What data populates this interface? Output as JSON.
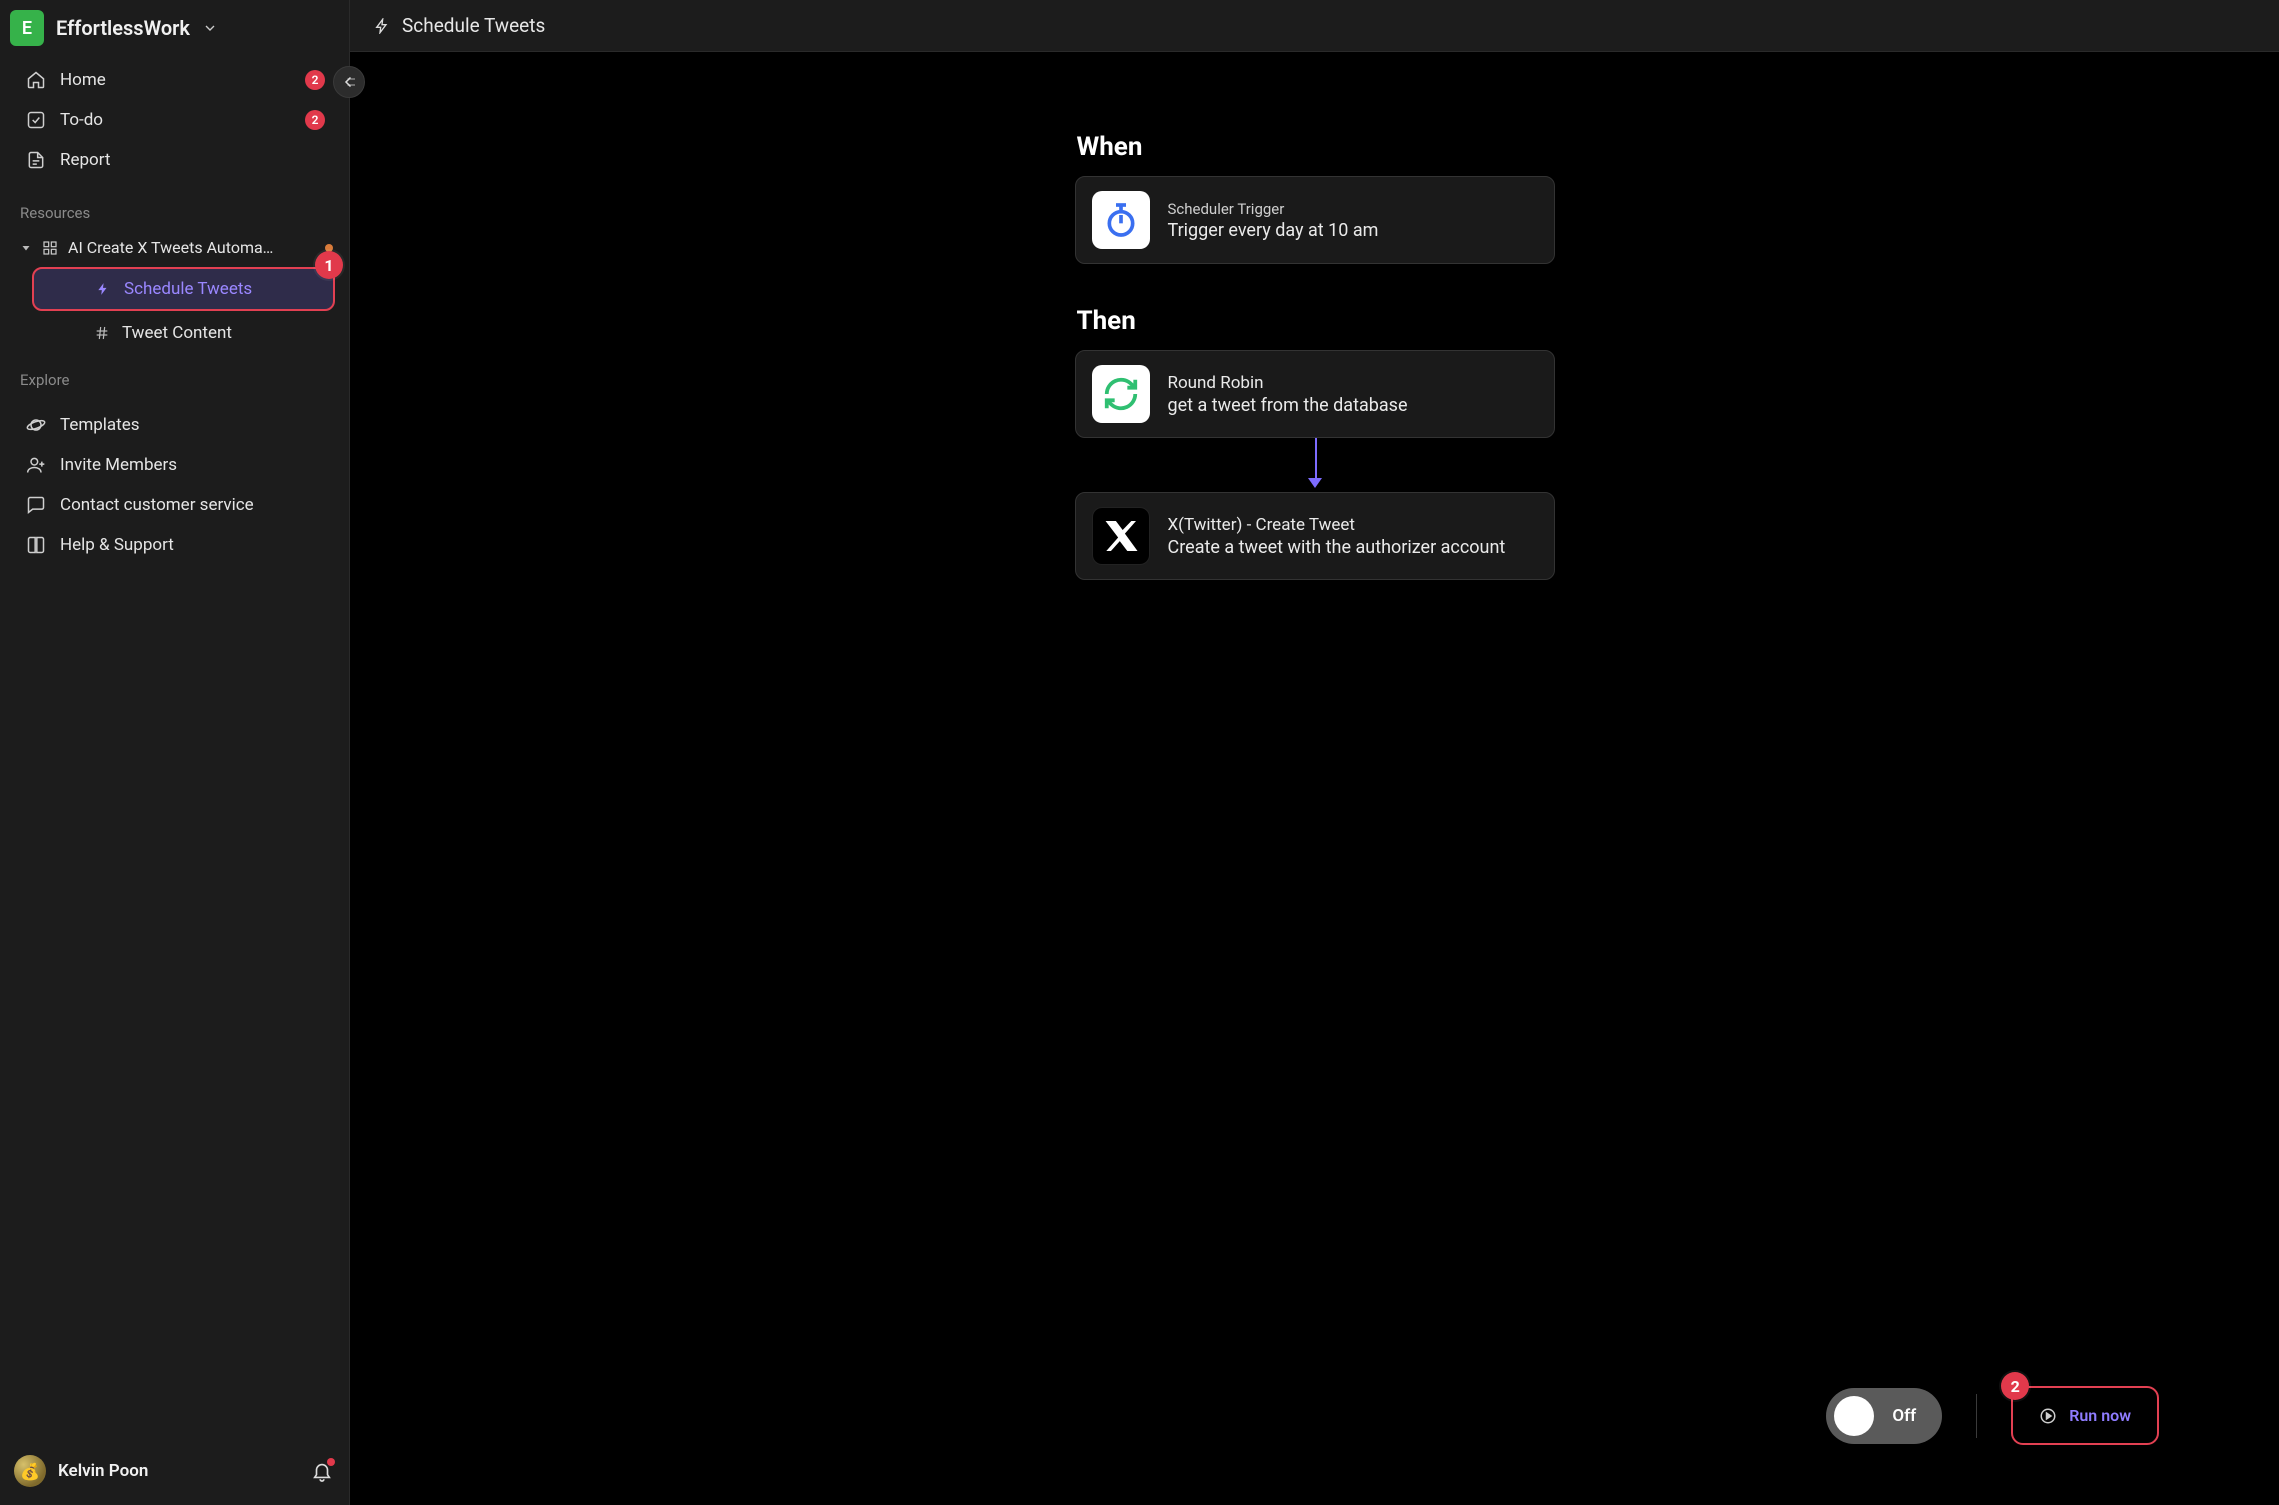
{
  "workspace": {
    "logo_letter": "E",
    "name": "EffortlessWork"
  },
  "nav": {
    "home": {
      "label": "Home",
      "badge": "2"
    },
    "todo": {
      "label": "To-do",
      "badge": "2"
    },
    "report": {
      "label": "Report"
    }
  },
  "sections": {
    "resources": "Resources",
    "explore": "Explore"
  },
  "resource": {
    "name": "AI Create X Tweets Automa…",
    "children": {
      "schedule_tweets": {
        "label": "Schedule Tweets",
        "callout": "1"
      },
      "tweet_content": {
        "label": "Tweet Content"
      }
    }
  },
  "explore": {
    "templates": "Templates",
    "invite": "Invite Members",
    "contact": "Contact customer service",
    "help": "Help & Support"
  },
  "user": {
    "name": "Kelvin Poon"
  },
  "page": {
    "title": "Schedule Tweets"
  },
  "flow": {
    "when_heading": "When",
    "then_heading": "Then",
    "trigger": {
      "title": "Scheduler Trigger",
      "subtitle": "Trigger every day at 10 am"
    },
    "steps": [
      {
        "title": "Round Robin",
        "subtitle": "get a tweet from the database",
        "icon": "refresh"
      },
      {
        "title": "X(Twitter) - Create Tweet",
        "subtitle": "Create a tweet with the authorizer account",
        "icon": "x"
      }
    ]
  },
  "controls": {
    "toggle_label": "Off",
    "run_now": "Run now",
    "run_callout": "2"
  }
}
